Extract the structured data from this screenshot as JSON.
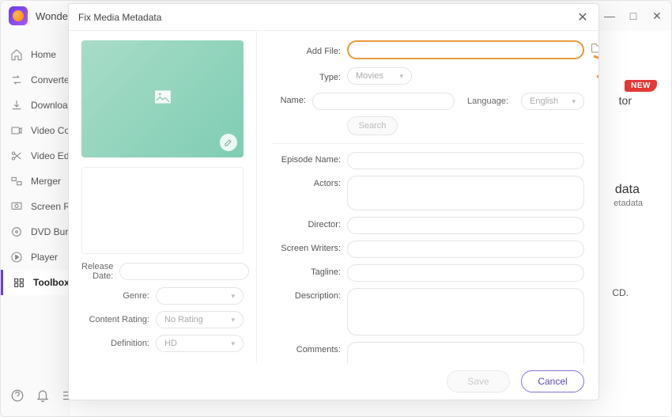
{
  "app": {
    "title": "Wonder"
  },
  "window_controls": {
    "min": "—",
    "max": "□",
    "close": "✕"
  },
  "sidebar": {
    "items": [
      {
        "label": "Home"
      },
      {
        "label": "Converte"
      },
      {
        "label": "Downloa"
      },
      {
        "label": "Video Co"
      },
      {
        "label": "Video Ed"
      },
      {
        "label": "Merger"
      },
      {
        "label": "Screen R"
      },
      {
        "label": "DVD Bur"
      },
      {
        "label": "Player"
      },
      {
        "label": "Toolbox"
      }
    ]
  },
  "background": {
    "new_badge": "NEW",
    "peek1": "tor",
    "peek2": "data",
    "peek3": "etadata",
    "peek4": "CD."
  },
  "dialog": {
    "title": "Fix Media Metadata",
    "add_file_label": "Add File:",
    "type_label": "Type:",
    "type_value": "Movies",
    "name_label": "Name:",
    "language_label": "Language:",
    "language_value": "English",
    "search_label": "Search",
    "episode_label": "Episode Name:",
    "actors_label": "Actors:",
    "director_label": "Director:",
    "writers_label": "Screen Writers:",
    "tagline_label": "Tagline:",
    "description_label": "Description:",
    "comments_label": "Comments:",
    "left": {
      "release_label": "Release Date:",
      "genre_label": "Genre:",
      "rating_label": "Content Rating:",
      "rating_value": "No Rating",
      "definition_label": "Definition:",
      "definition_value": "HD"
    },
    "save_label": "Save",
    "cancel_label": "Cancel"
  }
}
